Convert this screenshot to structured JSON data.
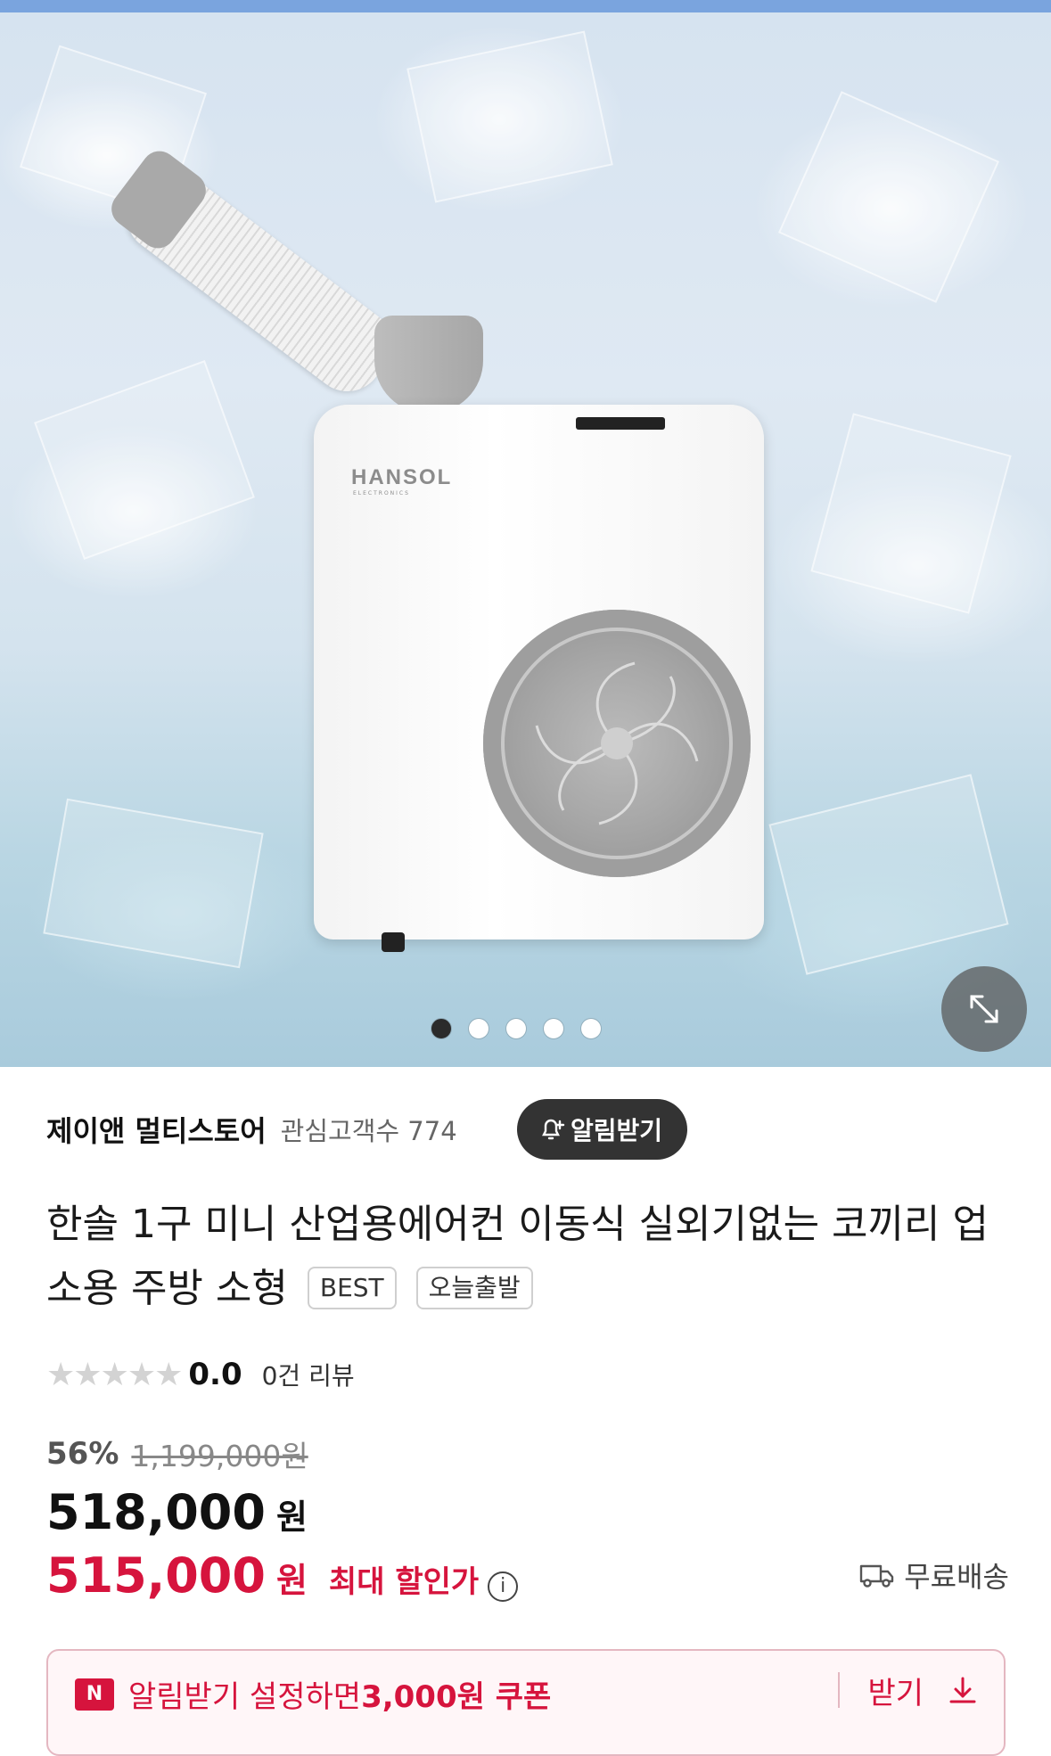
{
  "hero": {
    "product_brand_mark": "HANSOL",
    "product_brand_sub": "ELECTRONICS",
    "carousel": {
      "count": 5,
      "active_index": 0
    }
  },
  "store": {
    "name": "제이앤 멀티스토어",
    "fans_label": "관심고객수 774",
    "notify_label": "알림받기"
  },
  "product": {
    "title": "한솔 1구 미니 산업용에어컨 이동식 실외기없는 코끼리 업소용 주방 소형",
    "tags": [
      "BEST",
      "오늘출발"
    ]
  },
  "rating": {
    "stars": "★★★★★",
    "score": "0.0",
    "reviews": "0건 리뷰"
  },
  "pricing": {
    "discount_pct": "56%",
    "original_price": "1,199,000원",
    "price": "518,000",
    "price_unit": "원",
    "best_price": "515,000",
    "best_unit": "원",
    "best_label": "최대 할인가",
    "shipping": "무료배송"
  },
  "coupon": {
    "badge": "N",
    "text_prefix": "알림받기 설정하면 ",
    "text_amount": "3,000원 쿠폰",
    "cta": "받기"
  },
  "colors": {
    "accent_red": "#d6143d",
    "notify_bg": "#333333"
  }
}
